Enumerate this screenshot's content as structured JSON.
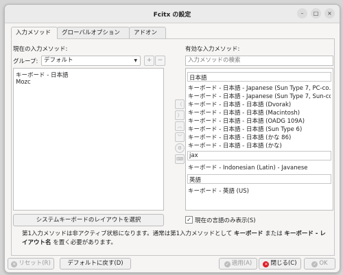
{
  "window": {
    "title": "Fcitx の設定",
    "minimize_glyph": "–",
    "maximize_glyph": "□",
    "close_glyph": "×"
  },
  "tabs": [
    {
      "label": "入力メソッド",
      "active": true
    },
    {
      "label": "グローバルオプション",
      "active": false
    },
    {
      "label": "アドオン",
      "active": false
    }
  ],
  "left": {
    "heading": "現在の入力メソッド:",
    "group_label": "グループ:",
    "group_value": "デフォルト",
    "add_glyph": "+",
    "remove_glyph": "−",
    "items": [
      "キーボード - 日本語",
      "Mozc"
    ],
    "layout_button": "システムキーボードのレイアウトを選択"
  },
  "middle_icons": [
    "chevron-left-icon",
    "chevron-right-icon",
    "chevron-up-icon",
    "chevron-down-icon",
    "gear-icon",
    "keyboard-icon"
  ],
  "right": {
    "heading": "有効な入力メソッド:",
    "search_placeholder": "入力メソッドの検索",
    "groups": [
      {
        "name": "日本語",
        "items": [
          "キーボード - 日本語 - Japanese (Sun Type 7, PC-co…",
          "キーボード - 日本語 - Japanese (Sun Type 7, Sun-co…",
          "キーボード - 日本語 - 日本語 (Dvorak)",
          "キーボード - 日本語 - 日本語 (Macintosh)",
          "キーボード - 日本語 - 日本語 (OADG 109A)",
          "キーボード - 日本語 - 日本語 (Sun Type 6)",
          "キーボード - 日本語 - 日本語 (かな 86)",
          "キーボード - 日本語 - 日本語 (かな)"
        ]
      },
      {
        "name": "jax",
        "items": [
          "キーボード - Indonesian (Latin) - Javanese"
        ]
      },
      {
        "name": "英語",
        "items": [
          "キーボード - 英語 (US)"
        ]
      }
    ],
    "only_current_language_label": "現在の言語のみ表示(S)",
    "only_current_language_checked": true
  },
  "note": {
    "part1": "第1入力メソッドは非アクティブ状態になります。通常は第1入力メソッドとして ",
    "bold1": "キーボード",
    "part2": " または ",
    "bold2": "キーボード - レイアウト名",
    "part3": " を置く必要があります。"
  },
  "footer": {
    "reset_label": "リセット(R)",
    "defaults_label": "デフォルトに戻す(D)",
    "apply_label": "適用(A)",
    "close_label": "閉じる(C)",
    "ok_label": "OK"
  },
  "colors": {
    "close_red": "#e01b24",
    "window_bg": "#f6f5f4"
  }
}
